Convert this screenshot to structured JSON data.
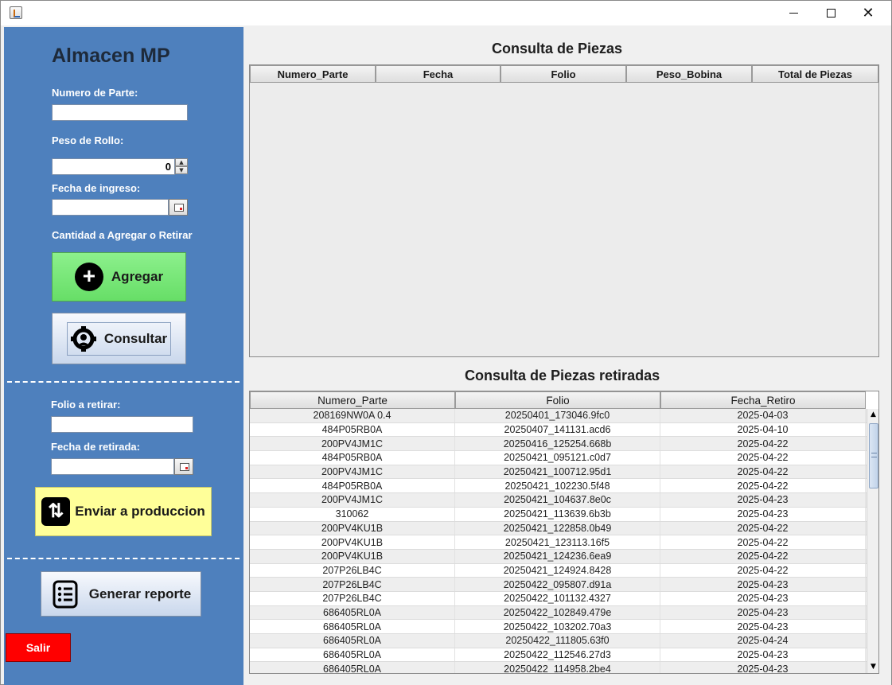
{
  "window": {
    "title": "",
    "icon": "java-app-icon"
  },
  "sidebar": {
    "title": "Almacen MP",
    "numero_parte_label": "Numero de Parte:",
    "numero_parte_value": "",
    "peso_rollo_label": "Peso de Rollo:",
    "peso_rollo_value": "0",
    "fecha_ingreso_label": "Fecha de ingreso:",
    "fecha_ingreso_value": "",
    "cantidad_label": "Cantidad a Agregar o Retirar",
    "agregar_label": "Agregar",
    "consultar_label": "Consultar",
    "folio_retirar_label": "Folio a retirar:",
    "folio_retirar_value": "",
    "fecha_retirada_label": "Fecha de retirada:",
    "fecha_retirada_value": "",
    "enviar_label": "Enviar a produccion",
    "reporte_label": "Generar reporte",
    "salir_label": "Salir"
  },
  "consulta_piezas": {
    "title": "Consulta de Piezas",
    "columns": [
      "Numero_Parte",
      "Fecha",
      "Folio",
      "Peso_Bobina",
      "Total de Piezas"
    ],
    "rows": []
  },
  "consulta_retiradas": {
    "title": "Consulta de Piezas retiradas",
    "columns": [
      "Numero_Parte",
      "Folio",
      "Fecha_Retiro"
    ],
    "rows": [
      [
        "208169NW0A 0.4",
        "20250401_173046.9fc0",
        "2025-04-03"
      ],
      [
        "484P05RB0A",
        "20250407_141131.acd6",
        "2025-04-10"
      ],
      [
        "200PV4JM1C",
        "20250416_125254.668b",
        "2025-04-22"
      ],
      [
        "484P05RB0A",
        "20250421_095121.c0d7",
        "2025-04-22"
      ],
      [
        "200PV4JM1C",
        "20250421_100712.95d1",
        "2025-04-22"
      ],
      [
        "484P05RB0A",
        "20250421_102230.5f48",
        "2025-04-22"
      ],
      [
        "200PV4JM1C",
        "20250421_104637.8e0c",
        "2025-04-23"
      ],
      [
        "310062",
        "20250421_113639.6b3b",
        "2025-04-23"
      ],
      [
        "200PV4KU1B",
        "20250421_122858.0b49",
        "2025-04-22"
      ],
      [
        "200PV4KU1B",
        "20250421_123113.16f5",
        "2025-04-22"
      ],
      [
        "200PV4KU1B",
        "20250421_124236.6ea9",
        "2025-04-22"
      ],
      [
        "207P26LB4C",
        "20250421_124924.8428",
        "2025-04-22"
      ],
      [
        "207P26LB4C",
        "20250422_095807.d91a",
        "2025-04-23"
      ],
      [
        "207P26LB4C",
        "20250422_101132.4327",
        "2025-04-23"
      ],
      [
        "686405RL0A",
        "20250422_102849.479e",
        "2025-04-23"
      ],
      [
        "686405RL0A",
        "20250422_103202.70a3",
        "2025-04-23"
      ],
      [
        "686405RL0A",
        "20250422_111805.63f0",
        "2025-04-24"
      ],
      [
        "686405RL0A",
        "20250422_112546.27d3",
        "2025-04-23"
      ],
      [
        "686405RL0A",
        "20250422_114958.2be4",
        "2025-04-23"
      ]
    ]
  },
  "colors": {
    "sidebar_bg": "#4e80bd",
    "agregar_bg": "#77e477",
    "enviar_bg": "#ffff99",
    "salir_bg": "#ff0000"
  }
}
